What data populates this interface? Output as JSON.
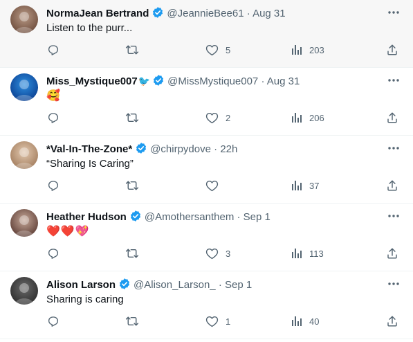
{
  "tweets": [
    {
      "name": "NormaJean Bertrand",
      "name_glyph": "",
      "handle": "@JeannieBee61",
      "separator": "·",
      "time": "Aug 31",
      "text": "Listen to the purr...",
      "likes": "5",
      "views": "203",
      "avatar_colors": [
        "#6b4a3a",
        "#b99a86"
      ],
      "highlight": true
    },
    {
      "name": "Miss_Mystique007",
      "name_glyph": "🐦",
      "handle": "@MissMystique007",
      "separator": "·",
      "time": "Aug 31",
      "text": "🥰",
      "likes": "2",
      "views": "206",
      "avatar_colors": [
        "#0a3d8f",
        "#2e8fe0"
      ],
      "highlight": false
    },
    {
      "name": "*Val-In-The-Zone*",
      "name_glyph": "",
      "handle": "@chirpydove",
      "separator": "·",
      "time": "22h",
      "text": "“Sharing Is Caring”",
      "likes": "",
      "views": "37",
      "avatar_colors": [
        "#a07a5a",
        "#e3c9b0"
      ],
      "highlight": false
    },
    {
      "name": "Heather Hudson",
      "name_glyph": "",
      "handle": "@Amothersanthem",
      "separator": "·",
      "time": "Sep 1",
      "text": "❤️❤️💖",
      "likes": "3",
      "views": "113",
      "avatar_colors": [
        "#5a3a32",
        "#c7a99a"
      ],
      "highlight": false
    },
    {
      "name": "Alison Larson",
      "name_glyph": "",
      "handle": "@Alison_Larson_",
      "separator": "·",
      "time": "Sep 1",
      "text": "Sharing is caring",
      "likes": "1",
      "views": "40",
      "avatar_colors": [
        "#2a2a2a",
        "#6a6a6a"
      ],
      "highlight": false
    }
  ],
  "icons": {
    "verified": "verified-badge-icon",
    "more": "more-options-icon",
    "reply": "reply-icon",
    "retweet": "retweet-icon",
    "like": "heart-icon",
    "views": "views-chart-icon",
    "share": "share-icon"
  },
  "colors": {
    "verified": "#1d9bf0",
    "muted": "#536471",
    "text": "#0f1419",
    "divider": "#eff3f4",
    "highlight_bg": "#f7f7f7"
  }
}
